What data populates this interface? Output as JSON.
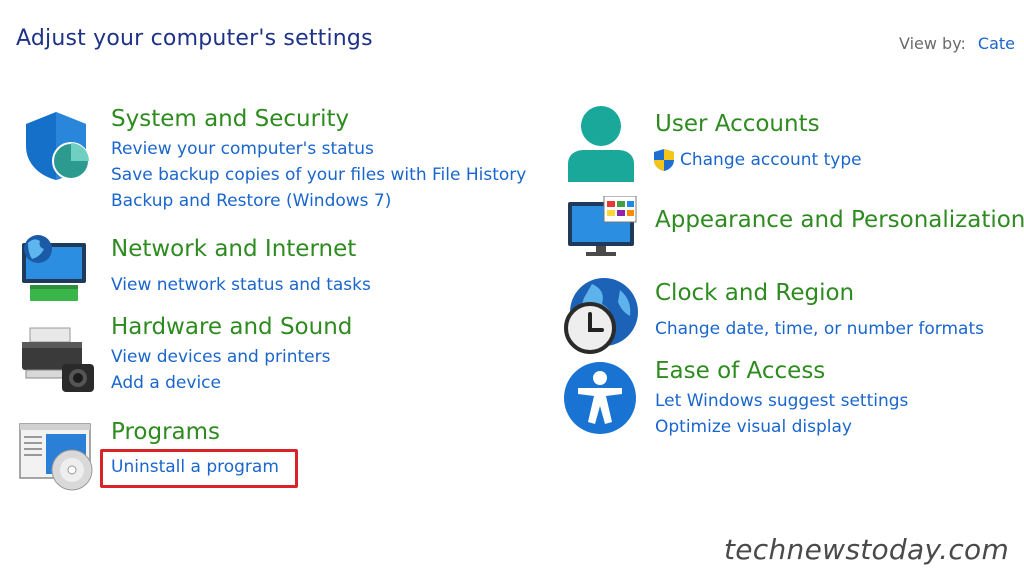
{
  "header": {
    "title": "Adjust your computer's settings",
    "view_by_label": "View by:",
    "view_by_value": "Cate"
  },
  "categories": {
    "system": {
      "title": "System and Security",
      "links": [
        "Review your computer's status",
        "Save backup copies of your files with File History",
        "Backup and Restore (Windows 7)"
      ]
    },
    "network": {
      "title": "Network and Internet",
      "links": [
        "View network status and tasks"
      ]
    },
    "hardware": {
      "title": "Hardware and Sound",
      "links": [
        "View devices and printers",
        "Add a device"
      ]
    },
    "programs": {
      "title": "Programs",
      "links": [
        "Uninstall a program"
      ]
    },
    "user": {
      "title": "User Accounts",
      "links": [
        "Change account type"
      ]
    },
    "appearance": {
      "title": "Appearance and Personalization",
      "links": []
    },
    "clock": {
      "title": "Clock and Region",
      "links": [
        "Change date, time, or number formats"
      ]
    },
    "ease": {
      "title": "Ease of Access",
      "links": [
        "Let Windows suggest settings",
        "Optimize visual display"
      ]
    }
  },
  "icons": {
    "system": "shield-icon",
    "network": "network-monitor-icon",
    "hardware": "printer-icon",
    "programs": "programs-disc-icon",
    "user": "user-icon",
    "appearance": "appearance-monitor-icon",
    "clock": "clock-globe-icon",
    "ease": "accessibility-icon",
    "uac": "uac-shield-icon"
  },
  "colors": {
    "title_text": "#1e3287",
    "category_title": "#2e8b1f",
    "link": "#1a66cc",
    "highlight": "#d9232b"
  },
  "watermark": "technewstoday.com"
}
